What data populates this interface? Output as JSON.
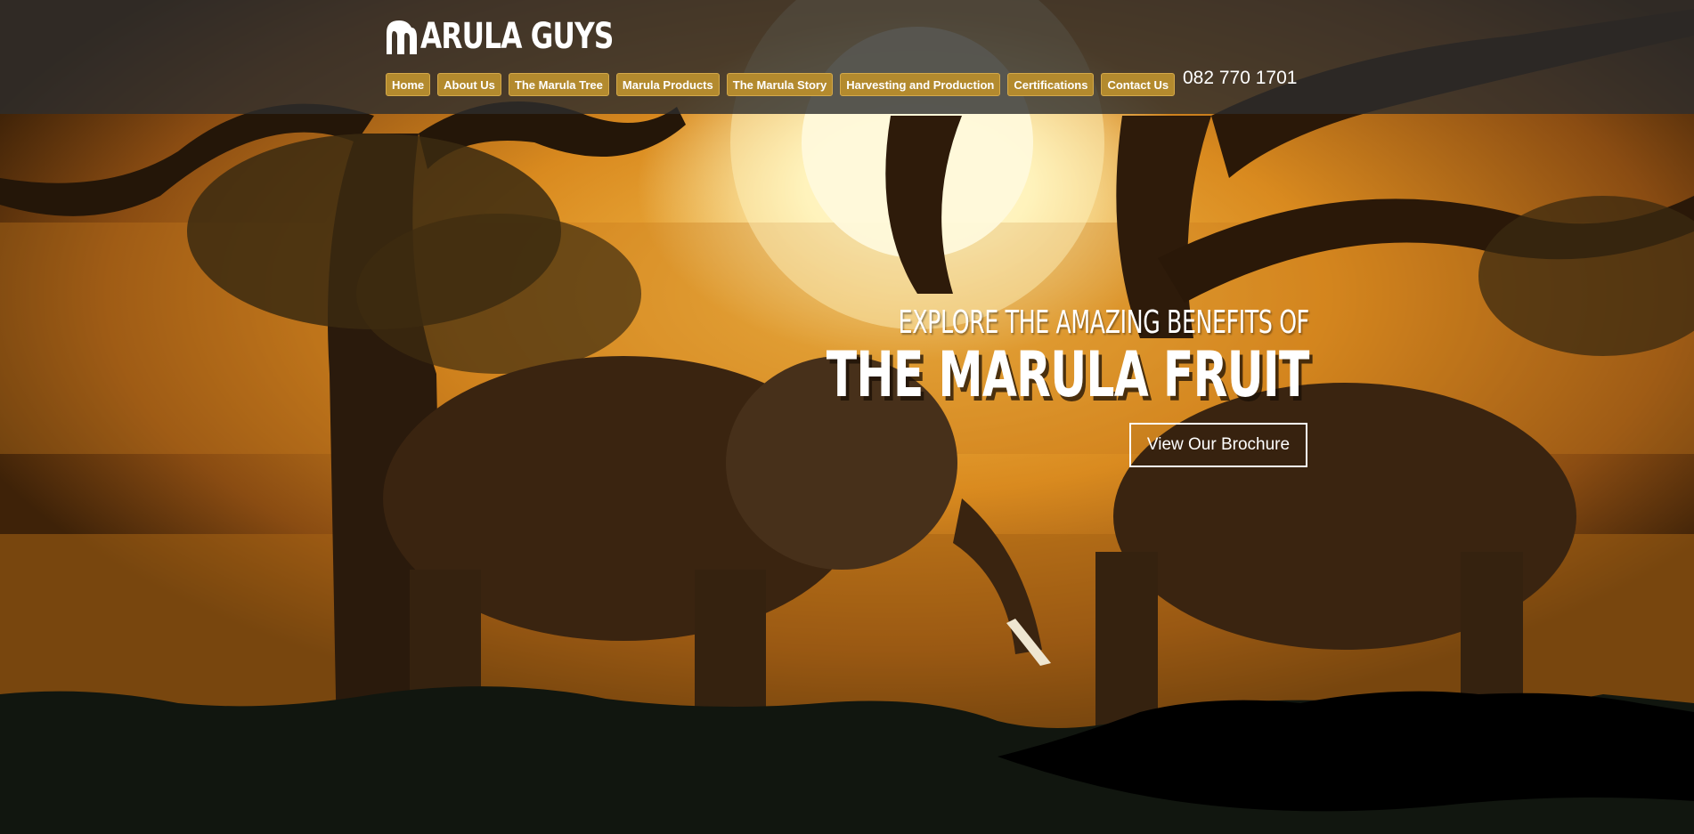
{
  "brand": {
    "name": "ARULA GUYS"
  },
  "nav": {
    "items": [
      {
        "label": "Home"
      },
      {
        "label": "About Us"
      },
      {
        "label": "The Marula Tree"
      },
      {
        "label": "Marula Products"
      },
      {
        "label": "The Marula Story"
      },
      {
        "label": "Harvesting and Production"
      },
      {
        "label": "Certifications"
      },
      {
        "label": "Contact Us"
      }
    ]
  },
  "contact": {
    "phone": "082 770 1701"
  },
  "hero": {
    "tagline": "EXPLORE THE AMAZING BENEFITS OF",
    "headline": "THE MARULA FRUIT",
    "cta_label": "View Our Brochure"
  },
  "colors": {
    "nav_button": "#b38a2e",
    "header_bg": "#2d2d2d",
    "footer_wave": "#11160f",
    "sunset_accent": "#f7c04e"
  }
}
